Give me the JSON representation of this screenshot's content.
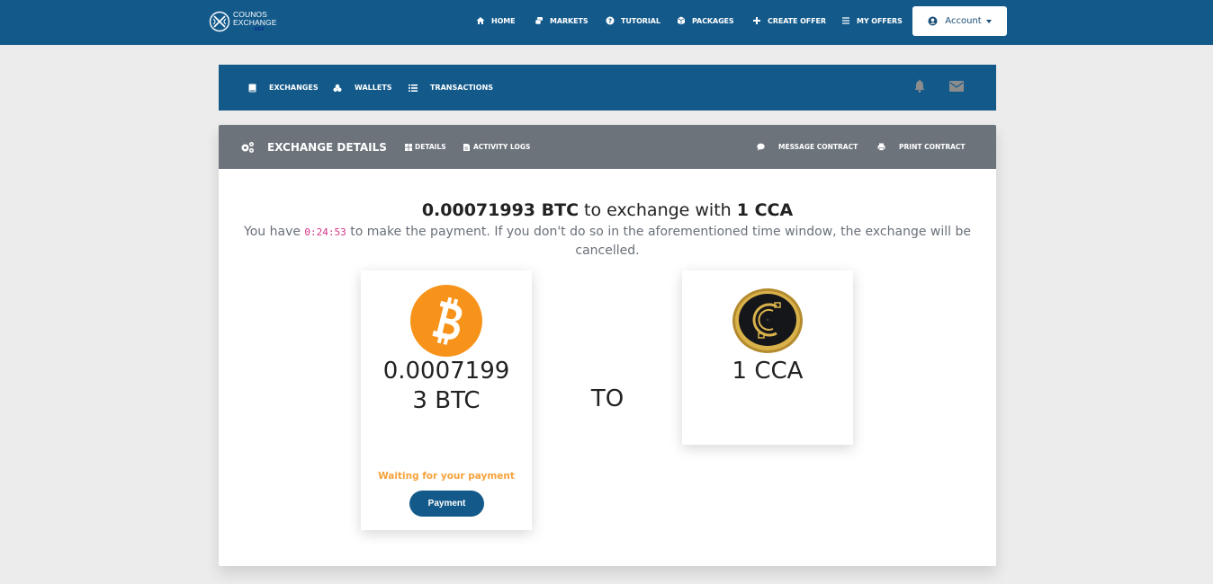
{
  "brand": {
    "line1": "COUNOS",
    "line2": "EXCHANGE",
    "tag": "DEX"
  },
  "nav": {
    "items": [
      {
        "label": "HOME",
        "icon": "home-icon"
      },
      {
        "label": "MARKETS",
        "icon": "markets-icon"
      },
      {
        "label": "TUTORIAL",
        "icon": "question-circle-icon"
      },
      {
        "label": "PACKAGES",
        "icon": "package-icon"
      },
      {
        "label": "CREATE OFFER",
        "icon": "plus-icon"
      },
      {
        "label": "MY OFFERS",
        "icon": "list-icon"
      }
    ],
    "account_label": "Account"
  },
  "subnav": {
    "items": [
      {
        "label": "EXCHANGES",
        "icon": "book-icon"
      },
      {
        "label": "WALLETS",
        "icon": "coins-icon"
      },
      {
        "label": "TRANSACTIONS",
        "icon": "list-icon"
      }
    ],
    "notifications_icon": "bell-icon",
    "messages_icon": "envelope-icon"
  },
  "card": {
    "title": "EXCHANGE DETAILS",
    "tabs": [
      {
        "label": "DETAILS",
        "icon": "table-icon"
      },
      {
        "label": "ACTIVITY LOGS",
        "icon": "file-icon"
      }
    ],
    "actions": [
      {
        "label": "MESSAGE CONTRACT",
        "icon": "comment-icon"
      },
      {
        "label": "PRINT CONTRACT",
        "icon": "print-icon"
      }
    ]
  },
  "exchange": {
    "give_amount": "0.00071993 BTC",
    "middle_text": " to exchange with ",
    "receive_amount": "1 CCA",
    "notice_before": "You have ",
    "timer": "0:24:53",
    "notice_after": " to make the payment. If you don't do so in the aforementioned time window, the exchange will be cancelled.",
    "from_coin": {
      "symbol": "BTC",
      "amount_line1": "0.0007199",
      "amount_line2": "3 BTC",
      "color": "#f7931a"
    },
    "to_label": "TO",
    "to_coin": {
      "symbol": "CCA",
      "amount": "1 CCA"
    },
    "status": "Waiting for your payment",
    "payment_button": "Payment"
  },
  "colors": {
    "primary": "#135a8b",
    "header_gray": "#6c737b",
    "status_orange": "#f6a23a",
    "timer_pink": "#d63384"
  }
}
